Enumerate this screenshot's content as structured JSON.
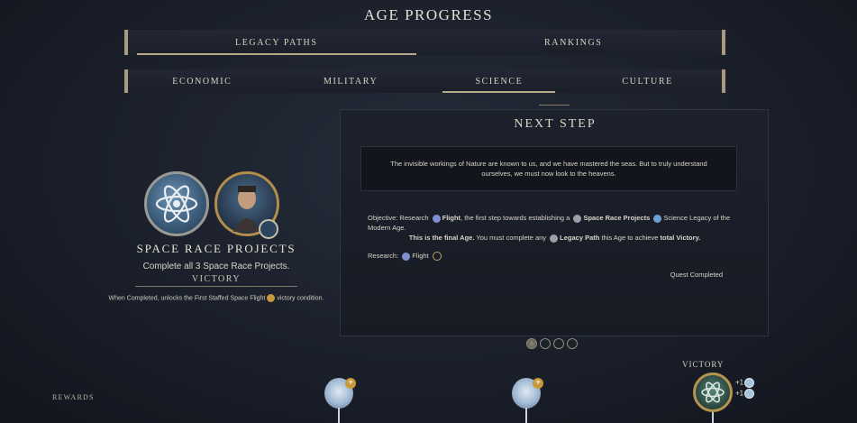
{
  "screen": {
    "title": "AGE PROGRESS"
  },
  "top_tabs": [
    {
      "label": "LEGACY PATHS",
      "active": true
    },
    {
      "label": "RANKINGS",
      "active": false
    }
  ],
  "sub_tabs": [
    {
      "label": "ECONOMIC",
      "active": false
    },
    {
      "label": "MILITARY",
      "active": false
    },
    {
      "label": "SCIENCE",
      "active": true
    },
    {
      "label": "CULTURE",
      "active": false
    }
  ],
  "legacy": {
    "title": "SPACE RACE PROJECTS",
    "subtitle": "Complete all 3 Space Race Projects.",
    "victory_label": "VICTORY",
    "note_before": "When Completed, unlocks the First Staffed Space Flight",
    "note_after": "victory condition.",
    "emblem_icon": "atom-icon",
    "leader_icon": "leader-portrait"
  },
  "next_step": {
    "title": "NEXT STEP",
    "quote": "The invisible workings of Nature are known to us, and we have mastered the seas. But to truly understand ourselves, we must now look to the heavens.",
    "objective": {
      "prefix": "Objective: Research",
      "tech": "Flight",
      "middle": ", the first step towards establishing a",
      "project": "Space Race Projects",
      "suffix": "Science Legacy of the Modern Age."
    },
    "final_age": {
      "bold": "This is the final Age.",
      "middle": "You must complete any",
      "path": "Legacy Path",
      "after": "this Age to achieve",
      "victory": "total Victory."
    },
    "research": {
      "label": "Research:",
      "tech": "Flight"
    },
    "quest_status": "Quest Completed"
  },
  "pager": {
    "count": 4,
    "active_index": 0
  },
  "rewards": {
    "label": "REWARDS",
    "victory_label": "VICTORY",
    "bonus_1": "+1",
    "bonus_2": "+1"
  },
  "colors": {
    "accent_gold": "#b69450",
    "science_blue": "#6f93b2",
    "background": "#1a1f2a"
  }
}
